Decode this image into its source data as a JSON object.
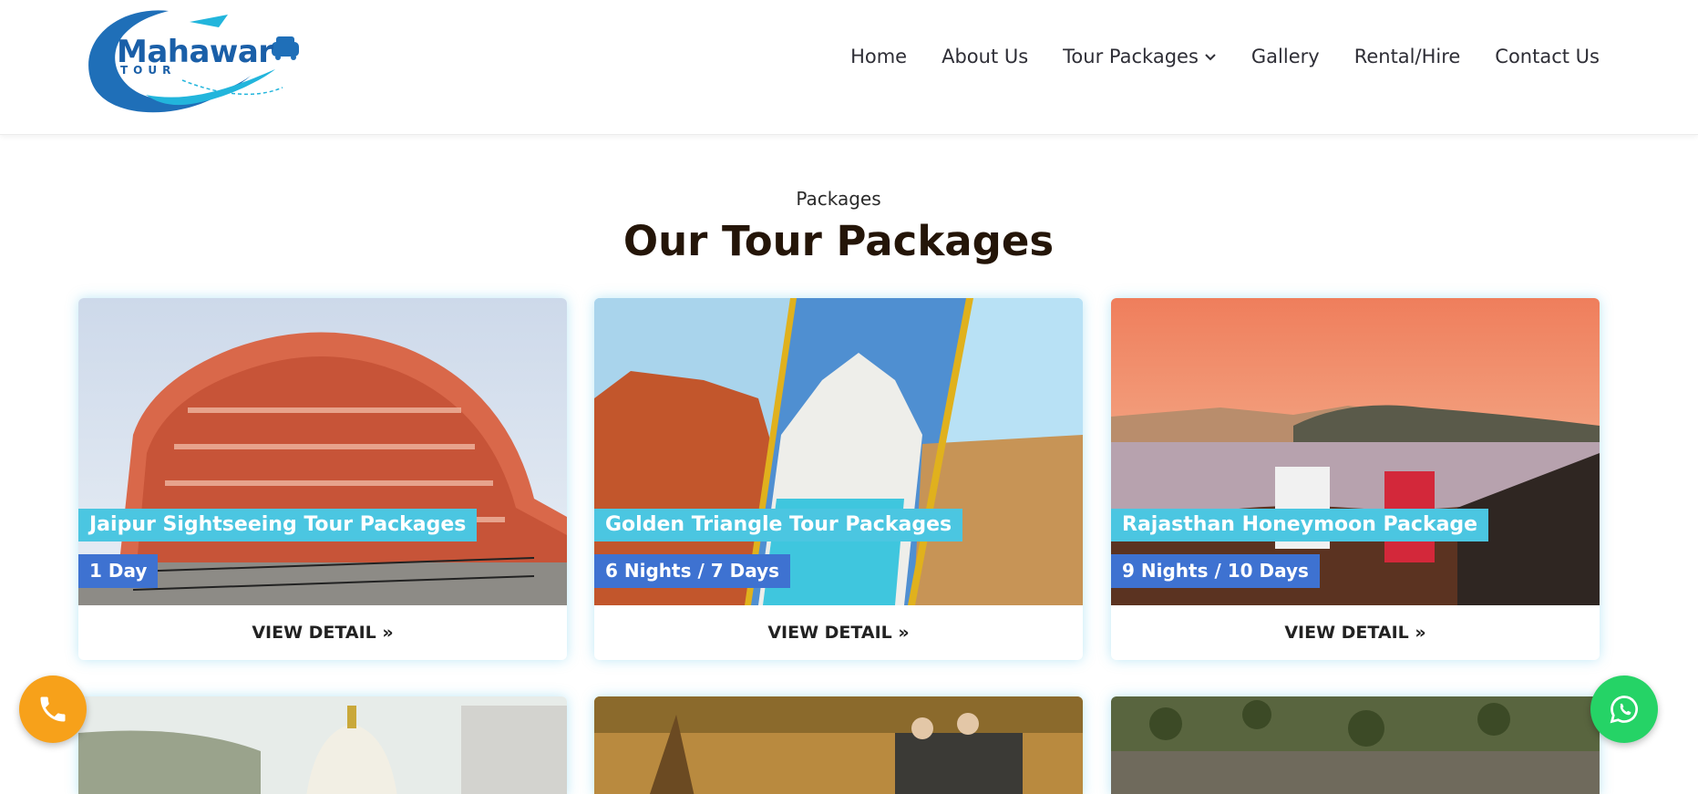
{
  "header": {
    "logo": {
      "text": "Mahawar",
      "subtext": "TOUR",
      "alt": "Mahawar Tour logo"
    },
    "nav": [
      {
        "label": "Home"
      },
      {
        "label": "About Us"
      },
      {
        "label": "Tour Packages",
        "has_dropdown": true
      },
      {
        "label": "Gallery"
      },
      {
        "label": "Rental/Hire"
      },
      {
        "label": "Contact Us"
      }
    ]
  },
  "section": {
    "kicker": "Packages",
    "title": "Our Tour Packages"
  },
  "packages": [
    {
      "name": "Jaipur Sightseeing Tour Packages",
      "duration": "1 Day",
      "cta": "VIEW DETAIL »"
    },
    {
      "name": "Golden Triangle Tour Packages",
      "duration": "6 Nights / 7 Days",
      "cta": "VIEW DETAIL »"
    },
    {
      "name": "Rajasthan Honeymoon Package",
      "duration": "9 Nights / 10 Days",
      "cta": "VIEW DETAIL »"
    }
  ],
  "floating": {
    "call_icon": "phone-icon",
    "whatsapp_icon": "whatsapp-icon"
  },
  "colors": {
    "brand_blue": "#1a5fa8",
    "name_tag": "#4bc6e1",
    "duration_tag": "#3e72d1",
    "title_brown": "#241508",
    "call_orange": "#f7a11a",
    "whatsapp_green": "#25d366"
  }
}
